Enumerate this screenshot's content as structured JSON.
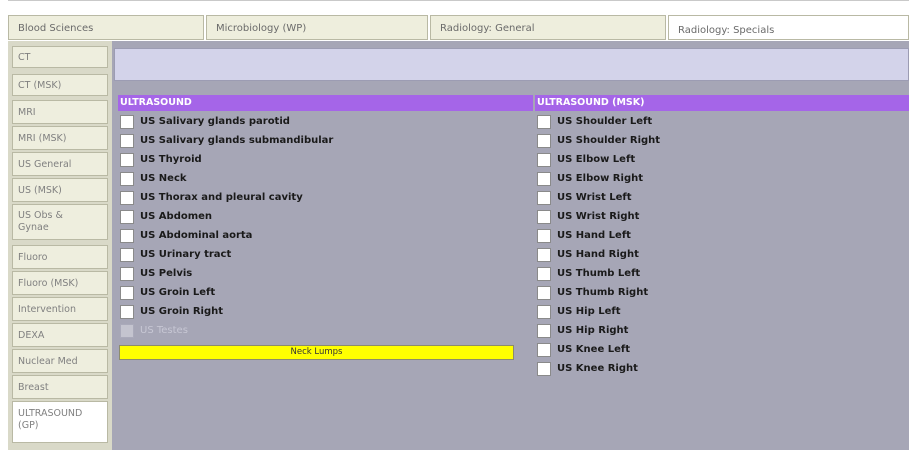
{
  "tabs": [
    {
      "label": "Blood Sciences",
      "active": false
    },
    {
      "label": "Microbiology (WP)",
      "active": false
    },
    {
      "label": "Radiology: General",
      "active": false
    },
    {
      "label": "Radiology: Specials",
      "active": true
    }
  ],
  "sidebar": {
    "items": [
      {
        "label": "CT"
      },
      {
        "label": "CT (MSK)"
      },
      {
        "label": "MRI"
      },
      {
        "label": "MRI (MSK)"
      },
      {
        "label": "US General"
      },
      {
        "label": "US (MSK)"
      },
      {
        "label": "US Obs & Gynae"
      },
      {
        "label": "Fluoro"
      },
      {
        "label": "Fluoro (MSK)"
      },
      {
        "label": "Intervention"
      },
      {
        "label": "DEXA"
      },
      {
        "label": "Nuclear Med"
      },
      {
        "label": "Breast"
      },
      {
        "label": "ULTRASOUND (GP)"
      }
    ]
  },
  "sections": {
    "left": {
      "title": "ULTRASOUND",
      "items": [
        {
          "label": "US Salivary glands parotid",
          "enabled": true
        },
        {
          "label": "US Salivary glands submandibular",
          "enabled": true
        },
        {
          "label": "US Thyroid",
          "enabled": true
        },
        {
          "label": "US Neck",
          "enabled": true
        },
        {
          "label": "US Thorax and pleural cavity",
          "enabled": true
        },
        {
          "label": "US Abdomen",
          "enabled": true
        },
        {
          "label": "US Abdominal aorta",
          "enabled": true
        },
        {
          "label": "US Urinary tract",
          "enabled": true
        },
        {
          "label": "US Pelvis",
          "enabled": true
        },
        {
          "label": "US Groin Left",
          "enabled": true
        },
        {
          "label": "US Groin Right",
          "enabled": true
        },
        {
          "label": "US Testes",
          "enabled": false
        }
      ],
      "button": "Neck Lumps"
    },
    "right": {
      "title": "ULTRASOUND (MSK)",
      "items": [
        {
          "label": "US Shoulder Left"
        },
        {
          "label": "US Shoulder Right"
        },
        {
          "label": "US Elbow Left"
        },
        {
          "label": "US Elbow Right"
        },
        {
          "label": "US Wrist Left"
        },
        {
          "label": "US Wrist Right"
        },
        {
          "label": "US Hand Left"
        },
        {
          "label": "US Hand Right"
        },
        {
          "label": "US Thumb Left"
        },
        {
          "label": "US Thumb Right"
        },
        {
          "label": "US Hip Left"
        },
        {
          "label": "US Hip Right"
        },
        {
          "label": "US Knee Left"
        },
        {
          "label": "US Knee Right"
        }
      ]
    }
  },
  "colors": {
    "header": "#a565e8",
    "panel": "#a6a6b6",
    "button": "#ffff00"
  }
}
